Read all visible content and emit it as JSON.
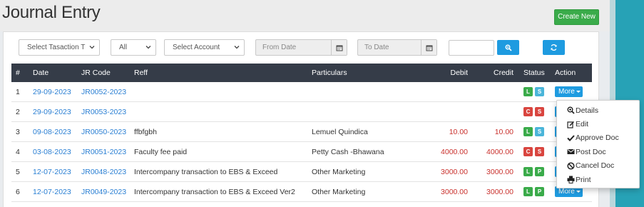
{
  "page": {
    "title": "Journal Entry",
    "create_label": "Create New"
  },
  "filters": {
    "transaction_type": "Select Tasaction T",
    "status": "All",
    "account": "Select Account",
    "from_date_placeholder": "From Date",
    "to_date_placeholder": "To Date"
  },
  "table": {
    "columns": [
      "#",
      "Date",
      "JR Code",
      "Reff",
      "Particulars",
      "Debit",
      "Credit",
      "Status",
      "Action"
    ],
    "rows": [
      {
        "num": "1",
        "date": "29-09-2023",
        "code": "JR0052-2023",
        "reff": "",
        "particulars": "",
        "debit": "",
        "credit": "",
        "badges": [
          "L",
          "S"
        ]
      },
      {
        "num": "2",
        "date": "29-09-2023",
        "code": "JR0053-2023",
        "reff": "",
        "particulars": "",
        "debit": "",
        "credit": "",
        "badges": [
          "C",
          "S"
        ]
      },
      {
        "num": "3",
        "date": "09-08-2023",
        "code": "JR0050-2023",
        "reff": "ffbfgbh",
        "particulars": "Lemuel Quindica",
        "debit": "10.00",
        "credit": "10.00",
        "badges": [
          "L",
          "S"
        ]
      },
      {
        "num": "4",
        "date": "03-08-2023",
        "code": "JR0051-2023",
        "reff": "Faculty fee paid",
        "particulars": "Petty Cash -Bhawana",
        "debit": "4000.00",
        "credit": "4000.00",
        "badges": [
          "C",
          "S"
        ]
      },
      {
        "num": "5",
        "date": "12-07-2023",
        "code": "JR0048-2023",
        "reff": "Intercompany transaction to EBS & Exceed",
        "particulars": "Other Marketing",
        "debit": "3000.00",
        "credit": "3000.00",
        "badges": [
          "L",
          "P"
        ]
      },
      {
        "num": "6",
        "date": "12-07-2023",
        "code": "JR0049-2023",
        "reff": "Intercompany transaction to EBS & Exceed Ver2",
        "particulars": "Other Marketing",
        "debit": "3000.00",
        "credit": "3000.00",
        "badges": [
          "L",
          "P"
        ]
      }
    ],
    "more_label": "More"
  },
  "menu": {
    "items": [
      {
        "label": "Details",
        "icon": "zoom-in-icon"
      },
      {
        "label": "Edit",
        "icon": "edit-icon"
      },
      {
        "label": "Approve Doc",
        "icon": "check-icon"
      },
      {
        "label": "Post Doc",
        "icon": "envelope-icon"
      },
      {
        "label": "Cancel Doc",
        "icon": "ban-icon"
      },
      {
        "label": "Print",
        "icon": "print-icon"
      }
    ]
  },
  "colors": {
    "primary": "#1e9be0",
    "success": "#3aab4a",
    "danger": "#d9453f",
    "info": "#4ab5d9",
    "header": "#353c48",
    "link": "#2a7fd3",
    "amount": "#c9302c"
  }
}
